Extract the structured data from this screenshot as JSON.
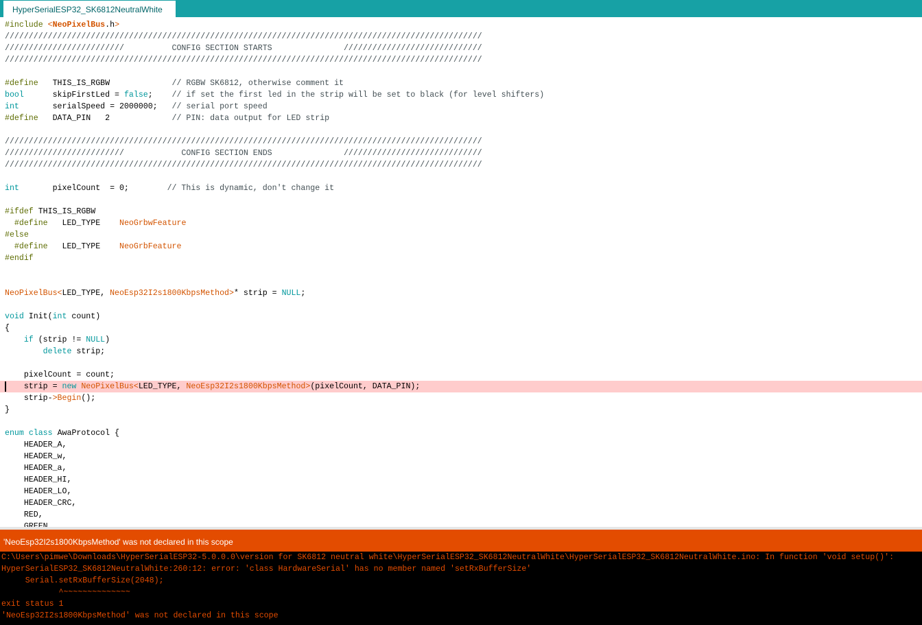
{
  "tab": {
    "title": "HyperSerialESP32_SK6812NeutralWhite"
  },
  "colors": {
    "tabbar": "#17a1a5",
    "error_bar": "#e34c00",
    "console_bg": "#000000",
    "error_line": "#ffcccc",
    "keyword": "#00979c",
    "directive": "#5e6d03",
    "library": "#d35400",
    "comment": "#434f54"
  },
  "code": [
    "#include <NeoPixelBus.h>",
    "////////////////////////////////////////////////////////////////////////////////////////////////////",
    "/////////////////////////          CONFIG SECTION STARTS               /////////////////////////////",
    "////////////////////////////////////////////////////////////////////////////////////////////////////",
    "",
    "#define   THIS_IS_RGBW             // RGBW SK6812, otherwise comment it",
    "bool      skipFirstLed = false;    // if set the first led in the strip will be set to black (for level shifters)",
    "int       serialSpeed = 2000000;   // serial port speed",
    "#define   DATA_PIN   2             // PIN: data output for LED strip",
    "",
    "////////////////////////////////////////////////////////////////////////////////////////////////////",
    "/////////////////////////            CONFIG SECTION ENDS               /////////////////////////////",
    "////////////////////////////////////////////////////////////////////////////////////////////////////",
    "",
    "int       pixelCount  = 0;        // This is dynamic, don't change it",
    "",
    "#ifdef THIS_IS_RGBW",
    "  #define   LED_TYPE    NeoGrbwFeature",
    "#else",
    "  #define   LED_TYPE    NeoGrbFeature",
    "#endif",
    "",
    "",
    "NeoPixelBus<LED_TYPE, NeoEsp32I2s1800KbpsMethod>* strip = NULL;",
    "",
    "void Init(int count)",
    "{",
    "    if (strip != NULL)",
    "        delete strip;",
    "",
    "    pixelCount = count;",
    "    strip = new NeoPixelBus<LED_TYPE, NeoEsp32I2s1800KbpsMethod>(pixelCount, DATA_PIN);",
    "    strip->Begin();",
    "}",
    "",
    "enum class AwaProtocol {",
    "    HEADER_A,",
    "    HEADER_w,",
    "    HEADER_a,",
    "    HEADER_HI,",
    "    HEADER_LO,",
    "    HEADER_CRC,",
    "    RED,",
    "    GREEN,"
  ],
  "error_line_index": 31,
  "status": {
    "message": "'NeoEsp32I2s1800KbpsMethod' was not declared in this scope"
  },
  "console": [
    "C:\\Users\\pimwe\\Downloads\\HyperSerialESP32-5.0.0.0\\version for SK6812 neutral white\\HyperSerialESP32_SK6812NeutralWhite\\HyperSerialESP32_SK6812NeutralWhite.ino: In function 'void setup()':",
    "HyperSerialESP32_SK6812NeutralWhite:260:12: error: 'class HardwareSerial' has no member named 'setRxBufferSize'",
    "     Serial.setRxBufferSize(2048);",
    "            ^~~~~~~~~~~~~~~",
    "exit status 1",
    "'NeoEsp32I2s1800KbpsMethod' was not declared in this scope"
  ]
}
